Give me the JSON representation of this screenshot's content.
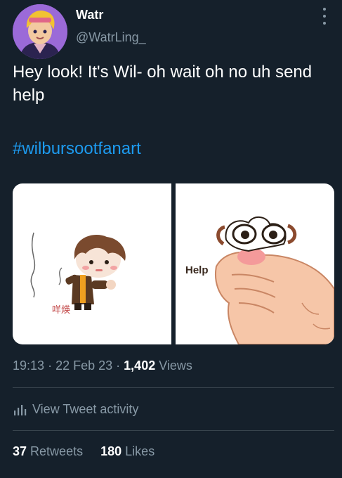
{
  "author": {
    "name": "Watr",
    "handle": "@WatrLing_"
  },
  "tweet": {
    "text": "Hey look! It's Wil- oh wait oh no uh send help",
    "hashtag": "#wilbursootfanart"
  },
  "media": {
    "left_signature": "咩煐",
    "right_caption": "Help"
  },
  "meta": {
    "time": "19:13",
    "date": "22 Feb 23",
    "views_count": "1,402",
    "views_label": "Views",
    "separator": "·"
  },
  "activity": {
    "label": "View Tweet activity",
    "icon": "bar-chart-icon"
  },
  "stats": {
    "retweets_count": "37",
    "retweets_label": "Retweets",
    "likes_count": "180",
    "likes_label": "Likes"
  },
  "colors": {
    "background": "#15202b",
    "text": "#ffffff",
    "secondary": "#8899a6",
    "link": "#1d9bf0",
    "divider": "#38444d"
  }
}
